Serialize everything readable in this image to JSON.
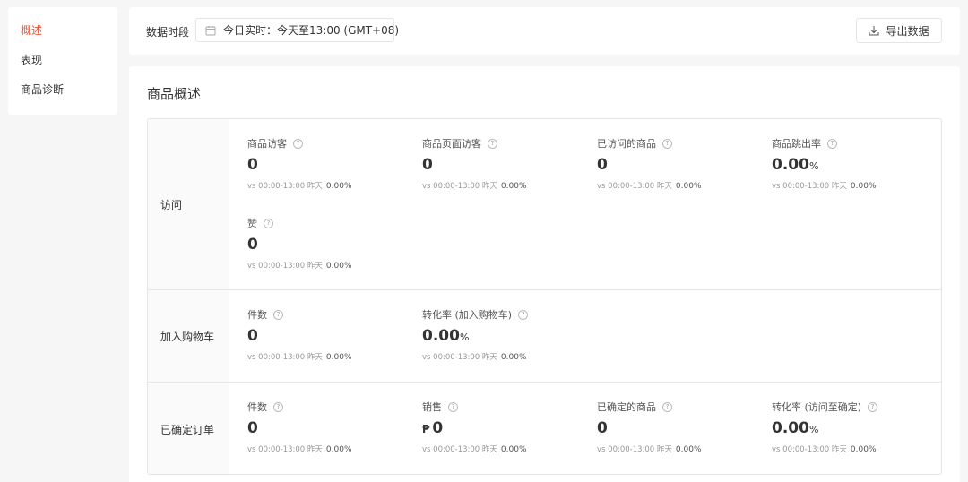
{
  "sidebar": {
    "items": [
      {
        "label": "概述",
        "active": true
      },
      {
        "label": "表现",
        "active": false
      },
      {
        "label": "商品诊断",
        "active": false
      }
    ]
  },
  "topbar": {
    "period_label": "数据时段",
    "date_range": "今日实时：今天至13:00 (GMT+08)",
    "export_label": "导出数据"
  },
  "overview": {
    "title": "商品概述",
    "compare_prefix": "vs 00:00-13:00 昨天",
    "groups": [
      {
        "label": "访问",
        "metrics": [
          {
            "name": "商品访客",
            "value": "0",
            "change": "0.00%"
          },
          {
            "name": "商品页面访客",
            "value": "0",
            "change": "0.00%"
          },
          {
            "name": "已访问的商品",
            "value": "0",
            "change": "0.00%"
          },
          {
            "name": "商品跳出率",
            "value": "0.00",
            "unit": "%",
            "change": "0.00%"
          },
          {
            "name": "赞",
            "value": "0",
            "change": "0.00%"
          }
        ]
      },
      {
        "label": "加入购物车",
        "metrics": [
          {
            "name": "件数",
            "value": "0",
            "change": "0.00%"
          },
          {
            "name": "转化率 (加入购物车)",
            "value": "0.00",
            "unit": "%",
            "change": "0.00%"
          }
        ]
      },
      {
        "label": "已确定订单",
        "metrics": [
          {
            "name": "件数",
            "value": "0",
            "change": "0.00%"
          },
          {
            "name": "销售",
            "currency": "₱",
            "value": "0",
            "change": "0.00%"
          },
          {
            "name": "已确定的商品",
            "value": "0",
            "change": "0.00%"
          },
          {
            "name": "转化率 (访问至确定)",
            "value": "0.00",
            "unit": "%",
            "change": "0.00%"
          }
        ]
      }
    ]
  },
  "colors": {
    "accent": "#ee4d2d",
    "border": "#e5e5e5",
    "page_bg": "#f6f6f6"
  }
}
